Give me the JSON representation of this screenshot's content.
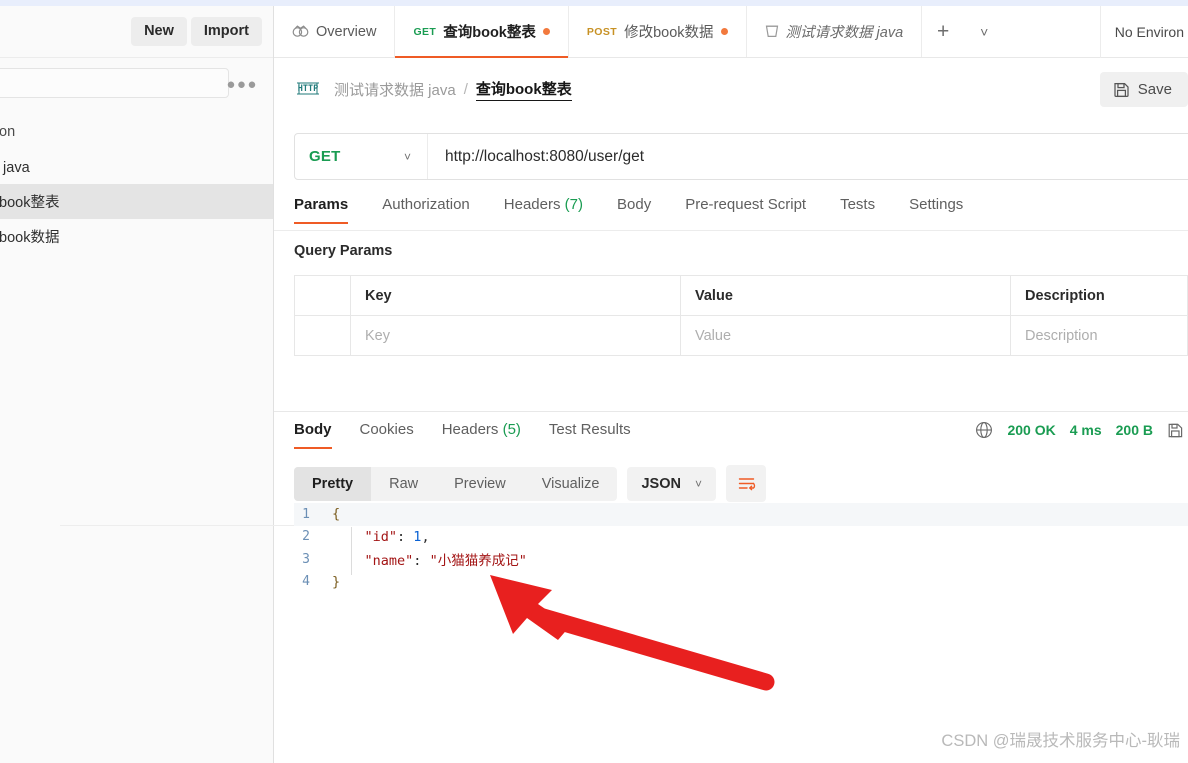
{
  "app": {
    "accent_orange": "#ef5b25",
    "green": "#1a9c52",
    "top_strip_color": "#e8eefc"
  },
  "sidebar": {
    "new_label": "New",
    "import_label": "Import",
    "search_placeholder": "",
    "more_icon": "more-horizontal-icon",
    "items": [
      {
        "label": "llection",
        "active": false
      },
      {
        "label": "数据 java",
        "active": false
      },
      {
        "label": "查询book整表",
        "active": true
      },
      {
        "label": "修改book数据",
        "active": false
      }
    ]
  },
  "tabbar": {
    "overview_label": "Overview",
    "overview_icon": "overview-icon",
    "tabs": [
      {
        "method": "GET",
        "method_class": "get",
        "name": "查询book整表",
        "dirty": true,
        "active": true,
        "italic": false
      },
      {
        "method": "POST",
        "method_class": "post",
        "name": "修改book数据",
        "dirty": true,
        "active": false,
        "italic": false
      },
      {
        "method": "",
        "method_class": "",
        "name": "测试请求数据 java",
        "dirty": false,
        "active": false,
        "italic": true,
        "icon": "collection-icon"
      }
    ],
    "add_tab_icon": "plus-icon",
    "tab_list_icon": "chevron-down-icon",
    "environment_label": "No Environ"
  },
  "breadcrumb": {
    "protocol_badge": "HTTP",
    "collection": "测试请求数据 java",
    "separator": "/",
    "current": "查询book整表"
  },
  "toolbar": {
    "save_label": "Save",
    "save_icon": "floppy-disk-icon"
  },
  "request": {
    "method": "GET",
    "method_caret_icon": "chevron-down-icon",
    "url": "http://localhost:8080/user/get",
    "tabs": [
      {
        "label": "Params",
        "count": "",
        "active": true
      },
      {
        "label": "Authorization",
        "count": "",
        "active": false
      },
      {
        "label": "Headers",
        "count": "(7)",
        "active": false
      },
      {
        "label": "Body",
        "count": "",
        "active": false
      },
      {
        "label": "Pre-request Script",
        "count": "",
        "active": false
      },
      {
        "label": "Tests",
        "count": "",
        "active": false
      },
      {
        "label": "Settings",
        "count": "",
        "active": false
      }
    ]
  },
  "query_params": {
    "title": "Query Params",
    "columns": [
      "",
      "Key",
      "Value",
      "Description"
    ],
    "rows": [
      {
        "key": "Key",
        "value": "Value",
        "description": "Description"
      }
    ]
  },
  "response": {
    "tabs": [
      {
        "label": "Body",
        "count": "",
        "active": true
      },
      {
        "label": "Cookies",
        "count": "",
        "active": false
      },
      {
        "label": "Headers",
        "count": "(5)",
        "active": false
      },
      {
        "label": "Test Results",
        "count": "",
        "active": false
      }
    ],
    "network_icon": "globe-icon",
    "status": "200 OK",
    "time": "4 ms",
    "size": "200 B",
    "save_response_icon": "save-response-icon",
    "view_modes": [
      {
        "label": "Pretty",
        "active": true
      },
      {
        "label": "Raw",
        "active": false
      },
      {
        "label": "Preview",
        "active": false
      },
      {
        "label": "Visualize",
        "active": false
      }
    ],
    "format": "JSON",
    "format_caret_icon": "chevron-down-icon",
    "wrap_icon": "wrap-lines-icon",
    "body_lines": [
      {
        "num": "1",
        "segments": [
          {
            "t": "{",
            "c": "brace"
          }
        ]
      },
      {
        "num": "2",
        "segments": [
          {
            "t": "    ",
            "c": "punct"
          },
          {
            "t": "\"id\"",
            "c": "k-str"
          },
          {
            "t": ": ",
            "c": "punct"
          },
          {
            "t": "1",
            "c": "k-num"
          },
          {
            "t": ",",
            "c": "punct"
          }
        ]
      },
      {
        "num": "3",
        "segments": [
          {
            "t": "    ",
            "c": "punct"
          },
          {
            "t": "\"name\"",
            "c": "k-str"
          },
          {
            "t": ": ",
            "c": "punct"
          },
          {
            "t": "\"小猫猫养成记\"",
            "c": "k-val-s"
          }
        ]
      },
      {
        "num": "4",
        "segments": [
          {
            "t": "}",
            "c": "brace"
          }
        ]
      }
    ]
  },
  "annotation": {
    "arrow_color": "#e8201f",
    "arrow_name": "red-arrow-annotation"
  },
  "watermark": {
    "text": "CSDN @瑞晟技术服务中心-耿瑞"
  }
}
